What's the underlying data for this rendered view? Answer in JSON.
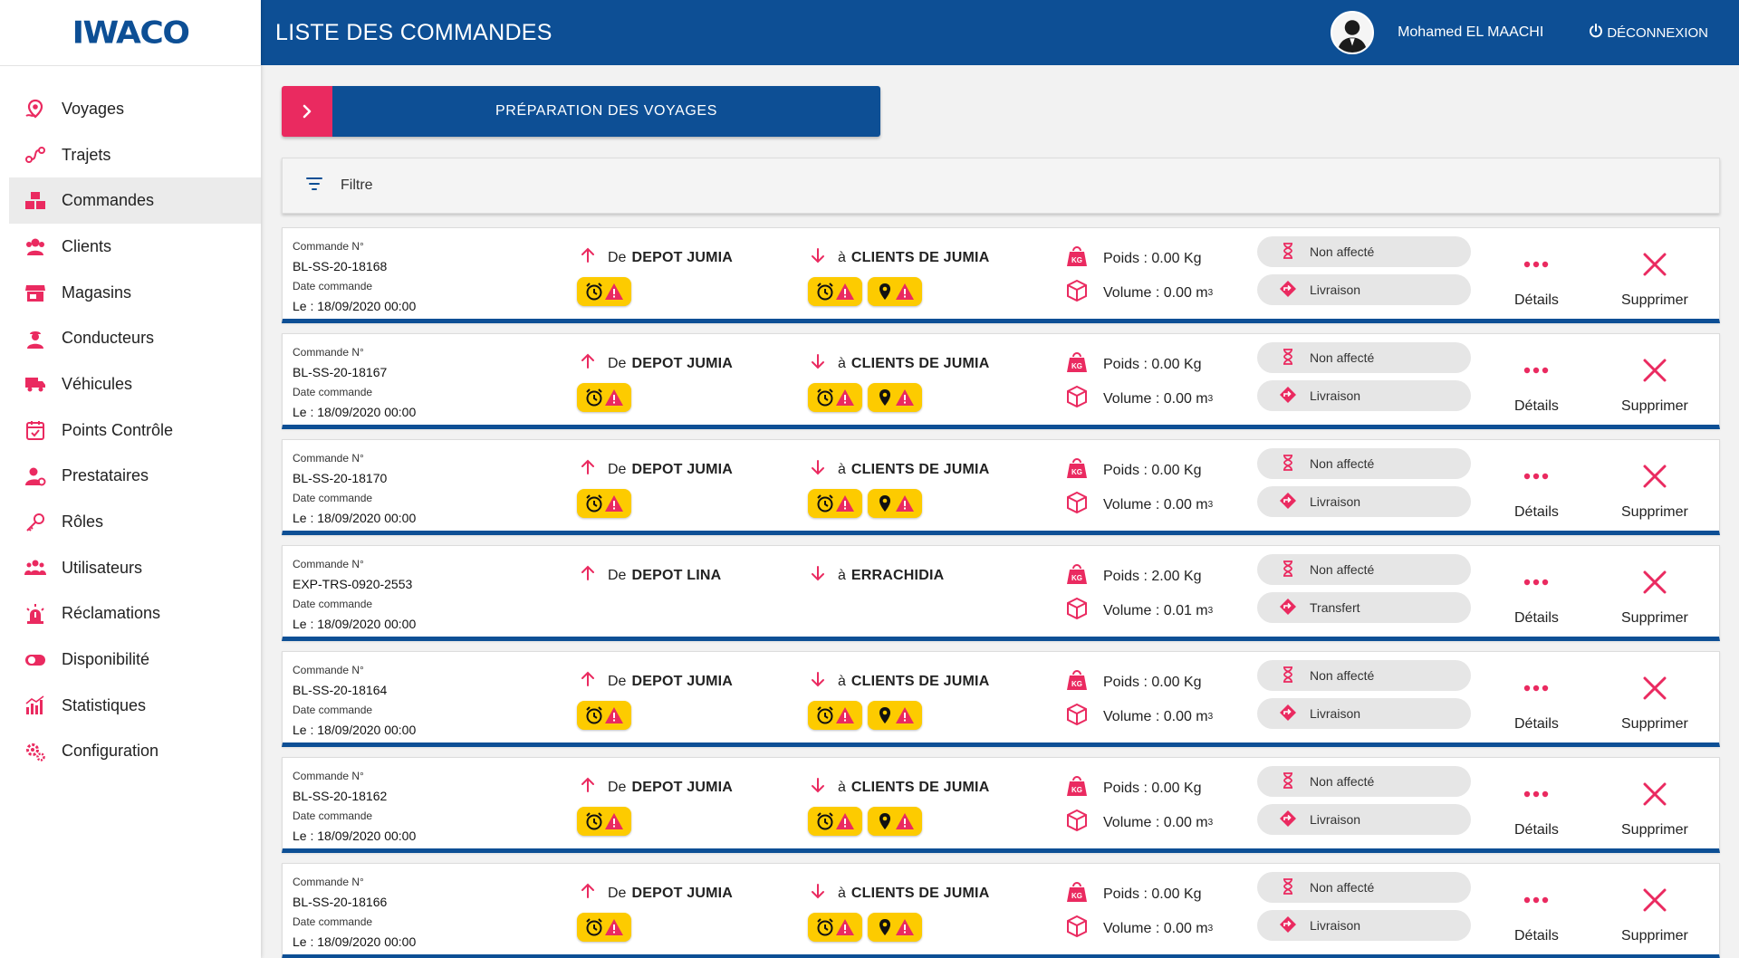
{
  "app": {
    "logo_text": "IWACO",
    "brand_color": "#0d4f95",
    "accent_color": "#ea2a60",
    "warning_color": "#fdcb00"
  },
  "header": {
    "title": "LISTE DES COMMANDES",
    "user_name": "Mohamed EL MAACHI",
    "logout_label": "DÉCONNEXION"
  },
  "sidebar": {
    "items": [
      {
        "label": "Voyages",
        "icon": "voyages-icon"
      },
      {
        "label": "Trajets",
        "icon": "route-icon"
      },
      {
        "label": "Commandes",
        "icon": "boxes-icon",
        "active": true
      },
      {
        "label": "Clients",
        "icon": "clients-icon"
      },
      {
        "label": "Magasins",
        "icon": "store-icon"
      },
      {
        "label": "Conducteurs",
        "icon": "driver-icon"
      },
      {
        "label": "Véhicules",
        "icon": "truck-icon"
      },
      {
        "label": "Points Contrôle",
        "icon": "calendar-check-icon"
      },
      {
        "label": "Prestataires",
        "icon": "user-cog-icon"
      },
      {
        "label": "Rôles",
        "icon": "key-icon"
      },
      {
        "label": "Utilisateurs",
        "icon": "users-icon"
      },
      {
        "label": "Réclamations",
        "icon": "alarm-icon"
      },
      {
        "label": "Disponibilité",
        "icon": "toggle-icon"
      },
      {
        "label": "Statistiques",
        "icon": "bar-chart-icon"
      },
      {
        "label": "Configuration",
        "icon": "gears-icon"
      }
    ]
  },
  "toolbar": {
    "prep_label": "PRÉPARATION DES VOYAGES",
    "filter_label": "Filtre"
  },
  "order_labels": {
    "number_label": "Commande N°",
    "date_label": "Date commande",
    "from_prefix": "De",
    "to_prefix": "à",
    "weight_prefix": "Poids :",
    "volume_prefix": "Volume :",
    "details_label": "Détails",
    "delete_label": "Supprimer"
  },
  "orders": [
    {
      "ref": "BL-SS-20-18168",
      "date": "Le : 18/09/2020 00:00",
      "from": "DEPOT JUMIA",
      "to": "CLIENTS DE JUMIA",
      "weight": "0.00 Kg",
      "volume": "0.00 m",
      "status": "Non affecté",
      "type": "Livraison",
      "warnings": true
    },
    {
      "ref": "BL-SS-20-18167",
      "date": "Le : 18/09/2020 00:00",
      "from": "DEPOT JUMIA",
      "to": "CLIENTS DE JUMIA",
      "weight": "0.00 Kg",
      "volume": "0.00 m",
      "status": "Non affecté",
      "type": "Livraison",
      "warnings": true
    },
    {
      "ref": "BL-SS-20-18170",
      "date": "Le : 18/09/2020 00:00",
      "from": "DEPOT JUMIA",
      "to": "CLIENTS DE JUMIA",
      "weight": "0.00 Kg",
      "volume": "0.00 m",
      "status": "Non affecté",
      "type": "Livraison",
      "warnings": true
    },
    {
      "ref": "EXP-TRS-0920-2553",
      "date": "Le : 18/09/2020 00:00",
      "from": "DEPOT LINA",
      "to": "ERRACHIDIA",
      "weight": "2.00 Kg",
      "volume": "0.01 m",
      "status": "Non affecté",
      "type": "Transfert",
      "warnings": false
    },
    {
      "ref": "BL-SS-20-18164",
      "date": "Le : 18/09/2020 00:00",
      "from": "DEPOT JUMIA",
      "to": "CLIENTS DE JUMIA",
      "weight": "0.00 Kg",
      "volume": "0.00 m",
      "status": "Non affecté",
      "type": "Livraison",
      "warnings": true
    },
    {
      "ref": "BL-SS-20-18162",
      "date": "Le : 18/09/2020 00:00",
      "from": "DEPOT JUMIA",
      "to": "CLIENTS DE JUMIA",
      "weight": "0.00 Kg",
      "volume": "0.00 m",
      "status": "Non affecté",
      "type": "Livraison",
      "warnings": true
    },
    {
      "ref": "BL-SS-20-18166",
      "date": "Le : 18/09/2020 00:00",
      "from": "DEPOT JUMIA",
      "to": "CLIENTS DE JUMIA",
      "weight": "0.00 Kg",
      "volume": "0.00 m",
      "status": "Non affecté",
      "type": "Livraison",
      "warnings": true
    }
  ]
}
